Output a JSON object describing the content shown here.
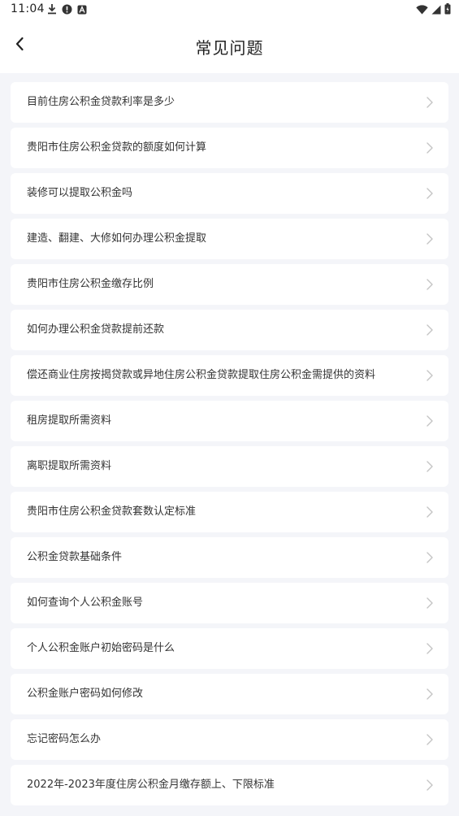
{
  "status": {
    "time": "11:04",
    "left_icons": [
      "download-icon",
      "alert-icon",
      "a-icon"
    ],
    "right_icons": [
      "wifi-icon",
      "signal-icon",
      "battery-icon"
    ]
  },
  "header": {
    "back_icon": "chevron-left-icon",
    "title": "常见问题"
  },
  "faq": {
    "items": [
      {
        "label": "目前住房公积金贷款利率是多少"
      },
      {
        "label": "贵阳市住房公积金贷款的额度如何计算"
      },
      {
        "label": "装修可以提取公积金吗"
      },
      {
        "label": "建造、翻建、大修如何办理公积金提取"
      },
      {
        "label": "贵阳市住房公积金缴存比例"
      },
      {
        "label": "如何办理公积金贷款提前还款"
      },
      {
        "label": "偿还商业住房按揭贷款或异地住房公积金贷款提取住房公积金需提供的资料"
      },
      {
        "label": "租房提取所需资料"
      },
      {
        "label": "离职提取所需资料"
      },
      {
        "label": "贵阳市住房公积金贷款套数认定标准"
      },
      {
        "label": "公积金贷款基础条件"
      },
      {
        "label": "如何查询个人公积金账号"
      },
      {
        "label": "个人公积金账户初始密码是什么"
      },
      {
        "label": "公积金账户密码如何修改"
      },
      {
        "label": "忘记密码怎么办"
      },
      {
        "label": "2022年-2023年度住房公积金月缴存额上、下限标准"
      }
    ],
    "chevron_icon": "chevron-right-icon"
  },
  "colors": {
    "background": "#f4f5f9",
    "card": "#ffffff",
    "text": "#333333",
    "chevron": "#c4c4c4"
  }
}
